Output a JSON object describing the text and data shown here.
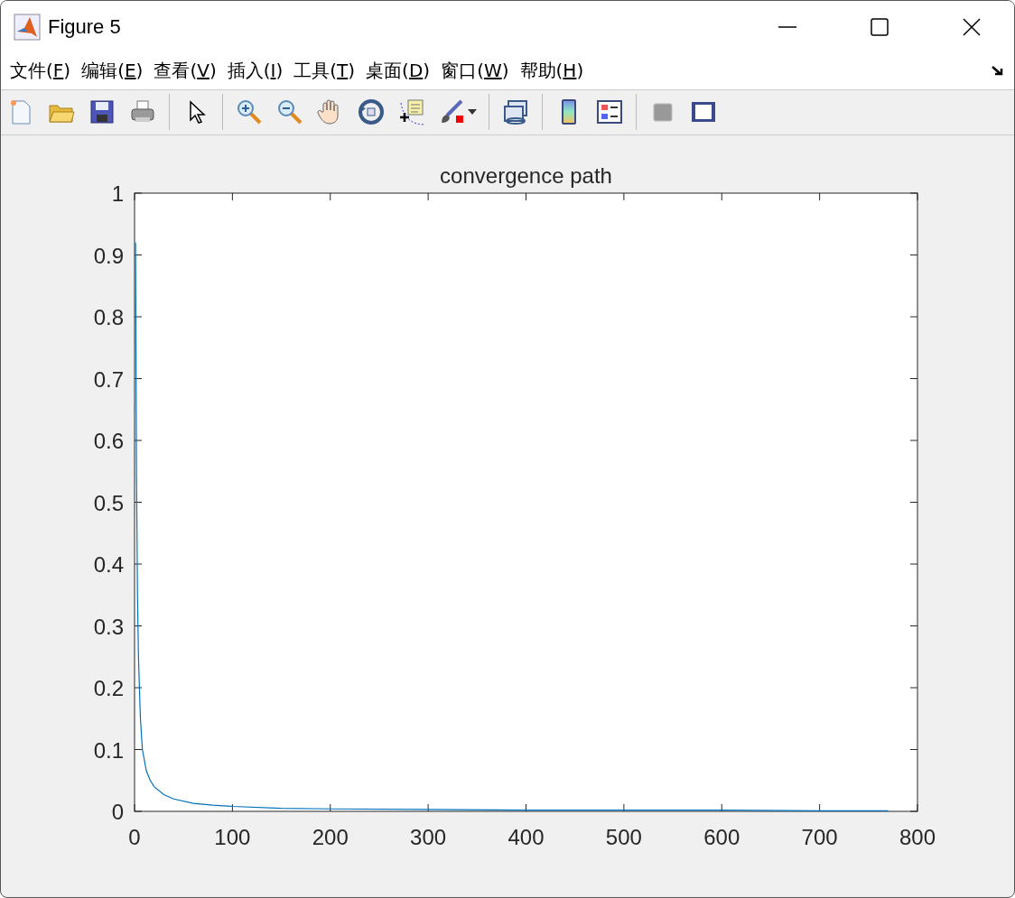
{
  "window": {
    "title": "Figure 5"
  },
  "menu": [
    {
      "before": "文件(",
      "key": "F",
      "after": ")"
    },
    {
      "before": "编辑(",
      "key": "E",
      "after": ")"
    },
    {
      "before": "查看(",
      "key": "V",
      "after": ")"
    },
    {
      "before": "插入(",
      "key": "I",
      "after": ")"
    },
    {
      "before": "工具(",
      "key": "T",
      "after": ")"
    },
    {
      "before": "桌面(",
      "key": "D",
      "after": ")"
    },
    {
      "before": "窗口(",
      "key": "W",
      "after": ")"
    },
    {
      "before": "帮助(",
      "key": "H",
      "after": ")"
    }
  ],
  "toolbar": [
    {
      "kind": "new"
    },
    {
      "kind": "open"
    },
    {
      "kind": "save"
    },
    {
      "kind": "print"
    },
    {
      "kind": "sep"
    },
    {
      "kind": "pointer"
    },
    {
      "kind": "sep"
    },
    {
      "kind": "zoom-in"
    },
    {
      "kind": "zoom-out"
    },
    {
      "kind": "pan"
    },
    {
      "kind": "rotate"
    },
    {
      "kind": "datatip"
    },
    {
      "kind": "brush"
    },
    {
      "kind": "sep"
    },
    {
      "kind": "link"
    },
    {
      "kind": "sep"
    },
    {
      "kind": "colorbar"
    },
    {
      "kind": "legend"
    },
    {
      "kind": "sep"
    },
    {
      "kind": "hide"
    },
    {
      "kind": "show"
    }
  ],
  "chart_data": {
    "type": "line",
    "title": "convergence path",
    "xlim": [
      0,
      800
    ],
    "ylim": [
      0,
      1
    ],
    "xticks": [
      0,
      100,
      200,
      300,
      400,
      500,
      600,
      700,
      800
    ],
    "yticks": [
      0,
      0.1,
      0.2,
      0.3,
      0.4,
      0.5,
      0.6,
      0.7,
      0.8,
      0.9,
      1
    ],
    "x": [
      1,
      2,
      3,
      4,
      6,
      8,
      12,
      16,
      20,
      30,
      40,
      60,
      80,
      100,
      150,
      200,
      300,
      400,
      500,
      600,
      700,
      770
    ],
    "series": [
      {
        "color": "#0072bd",
        "values": [
          0.92,
          0.55,
          0.35,
          0.25,
          0.15,
          0.1,
          0.066,
          0.05,
          0.04,
          0.027,
          0.02,
          0.013,
          0.01,
          0.008,
          0.005,
          0.004,
          0.003,
          0.002,
          0.002,
          0.002,
          0.001,
          0.001
        ]
      }
    ]
  }
}
